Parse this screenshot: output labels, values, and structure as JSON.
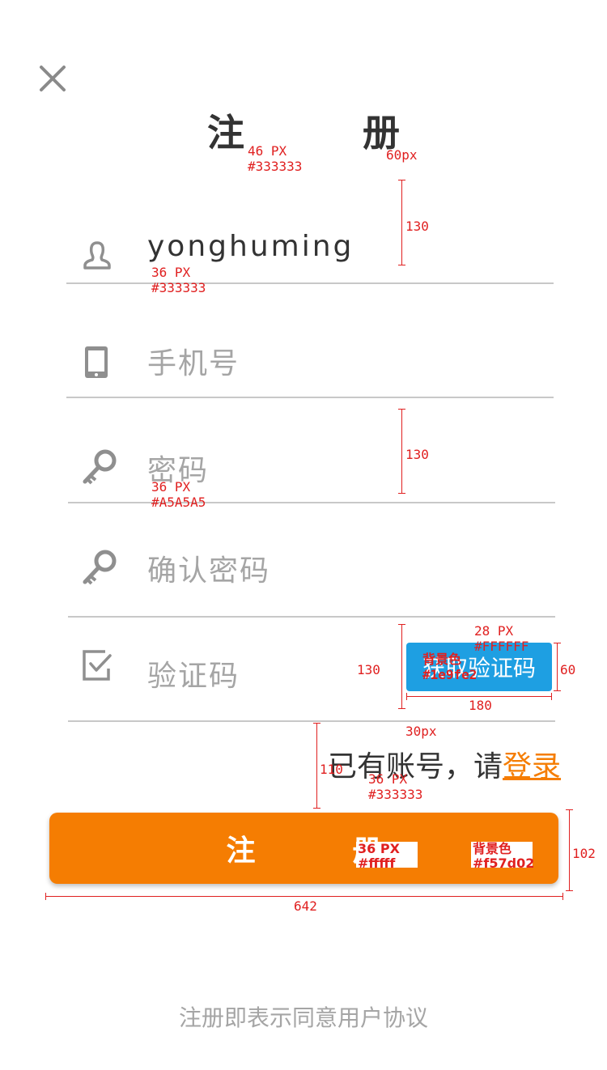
{
  "header": {
    "close_icon": "close-icon",
    "title": "注　册"
  },
  "form": {
    "username": {
      "icon": "user-icon",
      "value": "yonghuming"
    },
    "phone": {
      "icon": "phone-icon",
      "placeholder": "手机号"
    },
    "password": {
      "icon": "key-icon",
      "placeholder": "密码"
    },
    "confirm_password": {
      "icon": "key-icon",
      "placeholder": "确认密码"
    },
    "code": {
      "icon": "checkbox-icon",
      "placeholder": "验证码"
    },
    "get_code_label": "获取验证码"
  },
  "login_prompt": {
    "text": "已有账号，请",
    "link": "登录"
  },
  "register_button": "注　册",
  "agreement": "注册即表示同意用户协议",
  "colors": {
    "text": "#333333",
    "placeholder": "#A5A5A5",
    "accent_orange": "#f57d02",
    "accent_blue": "#1e9fe2",
    "white": "#FFFFFF"
  },
  "annotations": {
    "title_spec": "46 PX\n#333333",
    "title_gap": "60px",
    "row_h1": "130",
    "username_spec": "36 PX\n#333333",
    "row_h2": "130",
    "placeholder_spec": "36 PX\n#A5A5A5",
    "row_h3": "130",
    "btn_text_spec": "28 PX\n#FFFFFF",
    "btn_bg_spec": "背景色\n#1e9fe2",
    "btn_h": "60",
    "btn_w": "180",
    "gap30": "30px",
    "gap110": "110",
    "login_spec": "36 PX\n#333333",
    "reg_text_spec": "36 PX\n#fffff",
    "reg_bg_spec": "背景色\n#f57d02",
    "reg_h": "102",
    "reg_w": "642"
  }
}
